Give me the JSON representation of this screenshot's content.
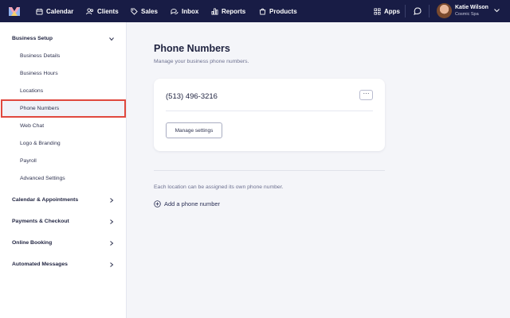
{
  "topnav": {
    "items": [
      {
        "label": "Calendar",
        "icon": "calendar-icon"
      },
      {
        "label": "Clients",
        "icon": "users-icon"
      },
      {
        "label": "Sales",
        "icon": "tag-icon"
      },
      {
        "label": "Inbox",
        "icon": "chat-icon"
      },
      {
        "label": "Reports",
        "icon": "bar-chart-icon"
      },
      {
        "label": "Products",
        "icon": "bag-icon"
      }
    ],
    "apps_label": "Apps",
    "user": {
      "name": "Katie Wilson",
      "org": "Cosmic Spa"
    }
  },
  "sidebar": {
    "business_setup": "Business Setup",
    "items": [
      "Business Details",
      "Business Hours",
      "Locations",
      "Phone Numbers",
      "Web Chat",
      "Logo & Branding",
      "Payroll",
      "Advanced Settings"
    ],
    "active_item": "Phone Numbers",
    "sections": [
      "Calendar & Appointments",
      "Payments & Checkout",
      "Online Booking",
      "Automated Messages"
    ]
  },
  "main": {
    "title": "Phone Numbers",
    "subtitle": "Manage your business phone numbers.",
    "phone_number": "(513) 496-3216",
    "more_label": "···",
    "manage_label": "Manage settings",
    "info_text": "Each location can be assigned its own phone number.",
    "add_label": "Add a phone number"
  },
  "colors": {
    "nav_bg": "#181c45",
    "highlight": "#e0483e",
    "page_bg": "#f4f5f9"
  }
}
